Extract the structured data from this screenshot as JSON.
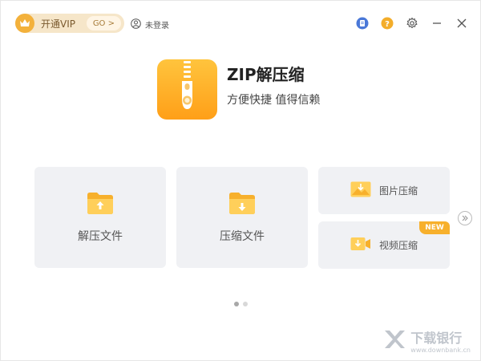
{
  "header": {
    "vip_label": "开通VIP",
    "vip_go": "GO >",
    "user_status": "未登录"
  },
  "brand": {
    "title": "ZIP解压缩",
    "subtitle": "方便快捷 值得信赖"
  },
  "actions": {
    "decompress": "解压文件",
    "compress": "压缩文件",
    "image_compress": "图片压缩",
    "video_compress": "视频压缩",
    "new_badge": "NEW"
  },
  "watermark": {
    "name": "下载银行",
    "url": "www.downbank.cn"
  },
  "colors": {
    "accent": "#f7b02c",
    "card_bg": "#f0f1f4",
    "blue_icon": "#4a78d8",
    "question_icon": "#f3ad2a"
  },
  "carousel": {
    "current_page": 1,
    "total_pages": 2
  }
}
